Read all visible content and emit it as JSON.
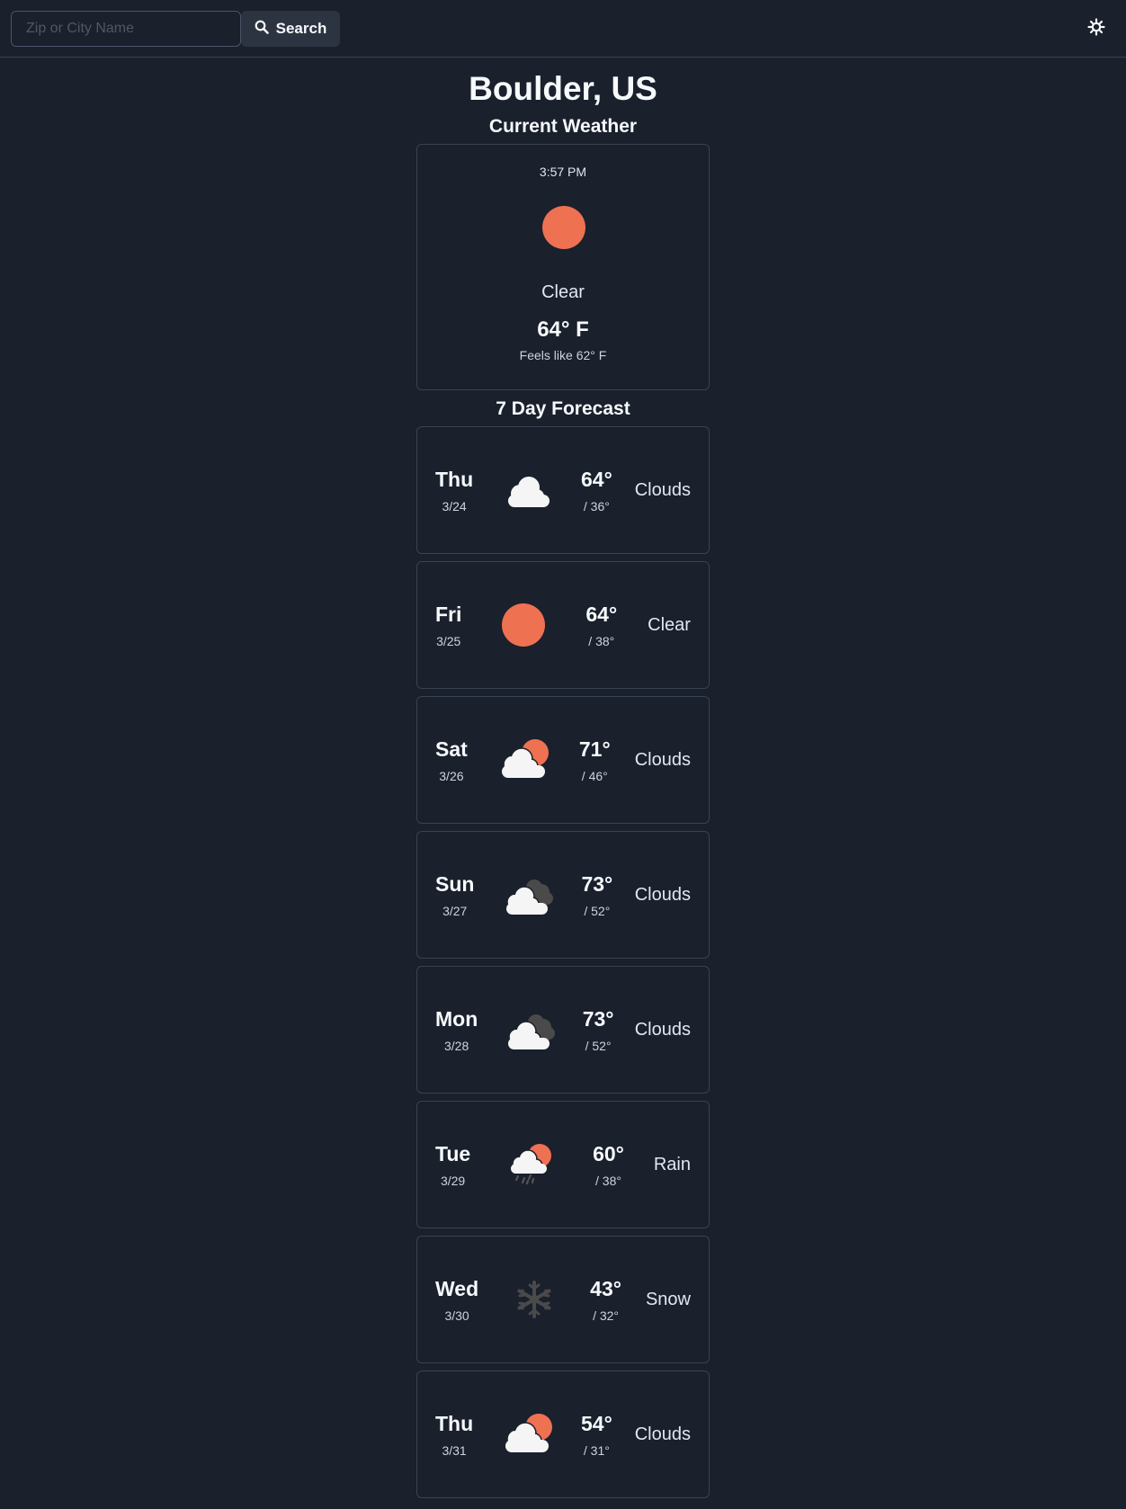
{
  "search": {
    "placeholder": "Zip or City Name",
    "value": "",
    "button_label": "Search",
    "button_icon": "search-icon"
  },
  "theme_toggle": {
    "icon": "sun-icon"
  },
  "location": {
    "title": "Boulder, US"
  },
  "current": {
    "heading": "Current Weather",
    "time": "3:57 PM",
    "icon": "clear",
    "condition": "Clear",
    "temperature": "64° F",
    "feels_like": "Feels like 62° F"
  },
  "forecast": {
    "heading": "7 Day Forecast",
    "days": [
      {
        "day": "Thu",
        "date": "3/24",
        "high": "64°",
        "low": "/ 36°",
        "condition": "Clouds",
        "icon": "clouds"
      },
      {
        "day": "Fri",
        "date": "3/25",
        "high": "64°",
        "low": "/ 38°",
        "condition": "Clear",
        "icon": "clear"
      },
      {
        "day": "Sat",
        "date": "3/26",
        "high": "71°",
        "low": "/ 46°",
        "condition": "Clouds",
        "icon": "few-clouds"
      },
      {
        "day": "Sun",
        "date": "3/27",
        "high": "73°",
        "low": "/ 52°",
        "condition": "Clouds",
        "icon": "broken-clouds"
      },
      {
        "day": "Mon",
        "date": "3/28",
        "high": "73°",
        "low": "/ 52°",
        "condition": "Clouds",
        "icon": "broken-clouds"
      },
      {
        "day": "Tue",
        "date": "3/29",
        "high": "60°",
        "low": "/ 38°",
        "condition": "Rain",
        "icon": "rain"
      },
      {
        "day": "Wed",
        "date": "3/30",
        "high": "43°",
        "low": "/ 32°",
        "condition": "Snow",
        "icon": "snow"
      },
      {
        "day": "Thu",
        "date": "3/31",
        "high": "54°",
        "low": "/ 31°",
        "condition": "Clouds",
        "icon": "few-clouds"
      }
    ]
  },
  "colors": {
    "background": "#1a202c",
    "card_border": "#3a4352",
    "sun": "#ee7152",
    "cloud": "#f5f5f5",
    "dark_cloud": "#4a4a4a"
  }
}
